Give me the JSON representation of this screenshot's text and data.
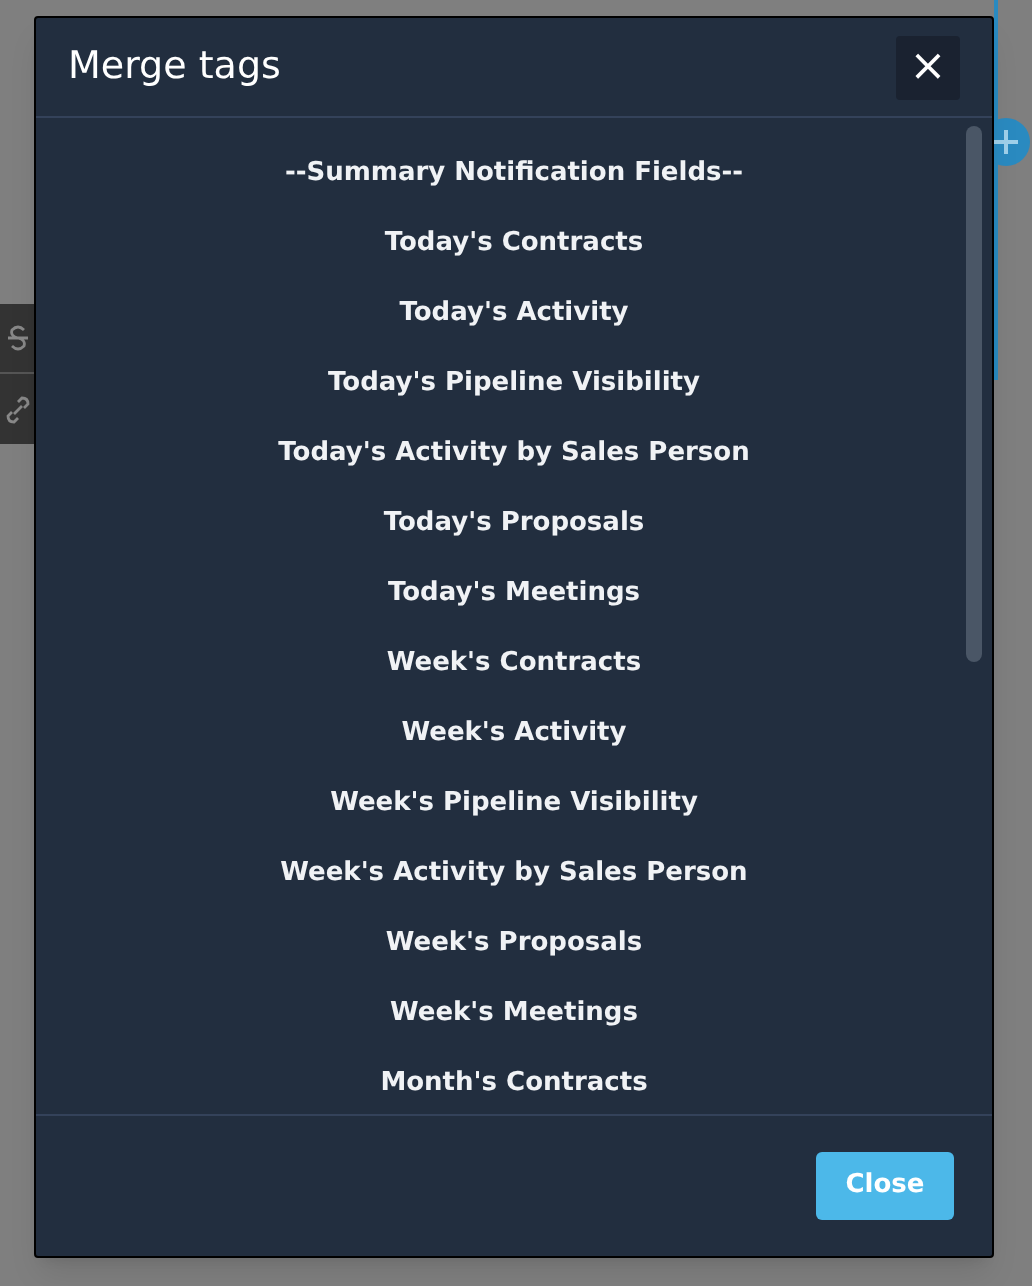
{
  "dialog": {
    "title": "Merge tags",
    "close_icon": "×",
    "tags": [
      "--Summary Notification Fields--",
      "Today's Contracts",
      "Today's Activity",
      "Today's Pipeline Visibility",
      "Today's Activity by Sales Person",
      "Today's Proposals",
      "Today's Meetings",
      "Week's Contracts",
      "Week's Activity",
      "Week's Pipeline Visibility",
      "Week's Activity by Sales Person",
      "Week's Proposals",
      "Week's Meetings",
      "Month's Contracts"
    ],
    "buttons": [
      "Close"
    ]
  }
}
